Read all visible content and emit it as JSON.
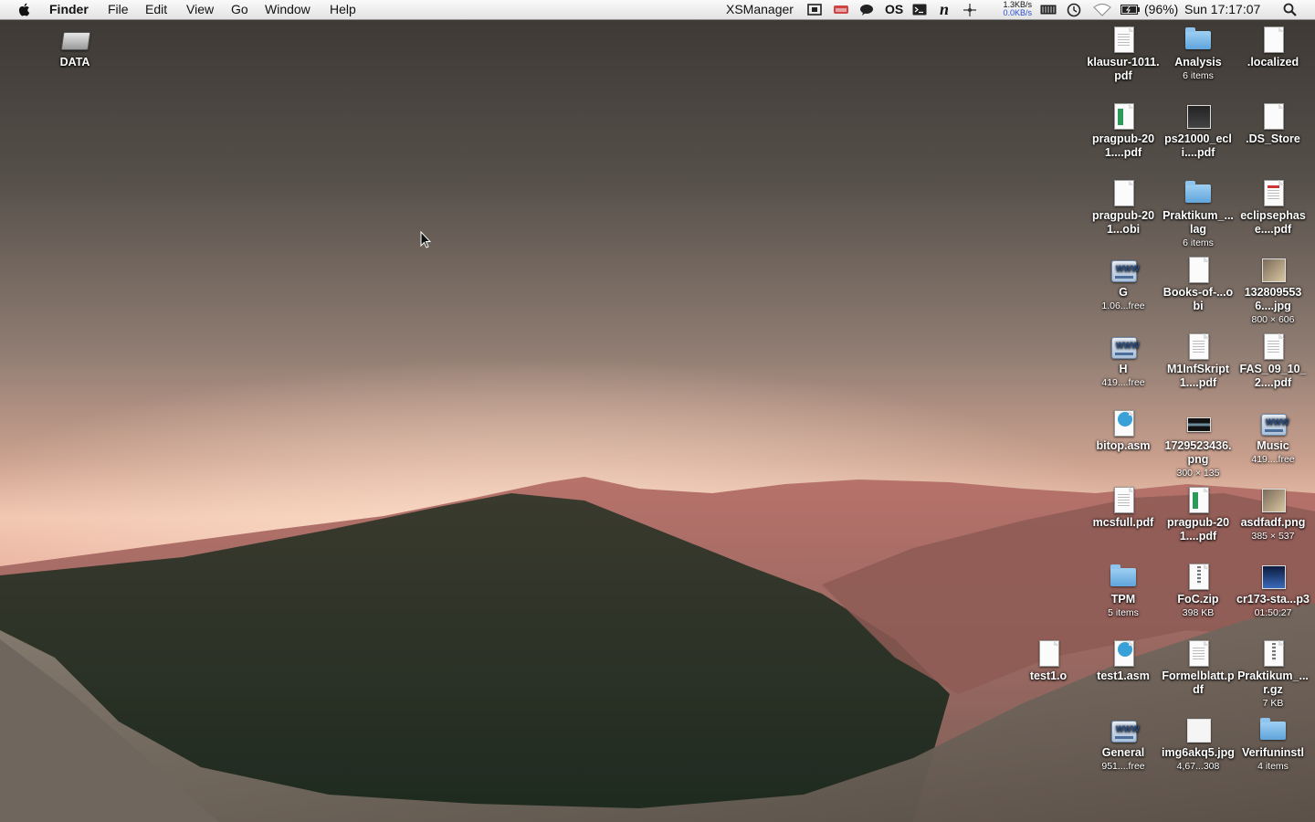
{
  "menubar": {
    "app_name": "Finder",
    "menus": [
      "File",
      "Edit",
      "View",
      "Go",
      "Window",
      "Help"
    ],
    "status": {
      "xsmanager": "XSManager",
      "os_label": "OS",
      "net_up": "1.3KB/s",
      "net_down": "0.0KB/s",
      "battery": "(96%)",
      "clock": "Sun 17:17:07"
    }
  },
  "desktop": {
    "left_items": [
      {
        "name": "DATA",
        "kind": "hard-drive"
      }
    ],
    "columns": [
      [
        {
          "name": "klausur-1011.pdf",
          "kind": "pdf"
        },
        {
          "name": "pragpub-201....pdf",
          "kind": "pdf-green"
        },
        {
          "name": "pragpub-201...obi",
          "kind": "document"
        },
        {
          "name": "G",
          "sub": "1.06...free",
          "kind": "network-drive"
        },
        {
          "name": "H",
          "sub": "419....free",
          "kind": "network-drive"
        },
        {
          "name": "bitop.asm",
          "kind": "asm"
        },
        {
          "name": "mcsfull.pdf",
          "kind": "pdf"
        },
        {
          "name": "TPM",
          "sub": "5 items",
          "kind": "folder"
        },
        {
          "name": "test1.asm",
          "kind": "asm"
        },
        {
          "name": "General",
          "sub": "951....free",
          "kind": "network-drive"
        }
      ],
      [
        {
          "name": "Analysis",
          "sub": "6 items",
          "kind": "folder"
        },
        {
          "name": "ps21000_ecli....pdf",
          "kind": "dark-thumb"
        },
        {
          "name": "Praktikum_...lag",
          "sub": "6 items",
          "kind": "folder"
        },
        {
          "name": "Books-of-...obi",
          "kind": "document"
        },
        {
          "name": "M1InfSkript1....pdf",
          "kind": "pdf"
        },
        {
          "name": "1729523436.png",
          "sub": "300 × 135",
          "kind": "png-thumb"
        },
        {
          "name": "pragpub-201....pdf",
          "kind": "pdf-green"
        },
        {
          "name": "FoC.zip",
          "sub": "398 KB",
          "kind": "zip"
        },
        {
          "name": "Formelblatt.pdf",
          "kind": "pdf"
        },
        {
          "name": "img6akq5.jpg",
          "sub": "4,67...308",
          "kind": "plain-thumb"
        }
      ],
      [
        {
          "name": ".localized",
          "kind": "document"
        },
        {
          "name": ".DS_Store",
          "kind": "document"
        },
        {
          "name": "eclipsephase....pdf",
          "kind": "pdf-red"
        },
        {
          "name": "1328095536....jpg",
          "sub": "800 × 606",
          "kind": "photo-thumb"
        },
        {
          "name": "FAS_09_10_2....pdf",
          "kind": "pdf"
        },
        {
          "name": "Music",
          "sub": "419....free",
          "kind": "network-drive"
        },
        {
          "name": "asdfadf.png",
          "sub": "385 × 537",
          "kind": "photo-thumb"
        },
        {
          "name": "cr173-sta...p3",
          "sub": "01:50:27",
          "kind": "audio-thumb"
        },
        {
          "name": "Praktikum_...r.gz",
          "sub": "7 KB",
          "kind": "zip"
        },
        {
          "name": "Verifuninstl",
          "sub": "4 items",
          "kind": "folder"
        }
      ]
    ],
    "extra_items": [
      {
        "name": "test1.o",
        "kind": "document"
      }
    ]
  }
}
